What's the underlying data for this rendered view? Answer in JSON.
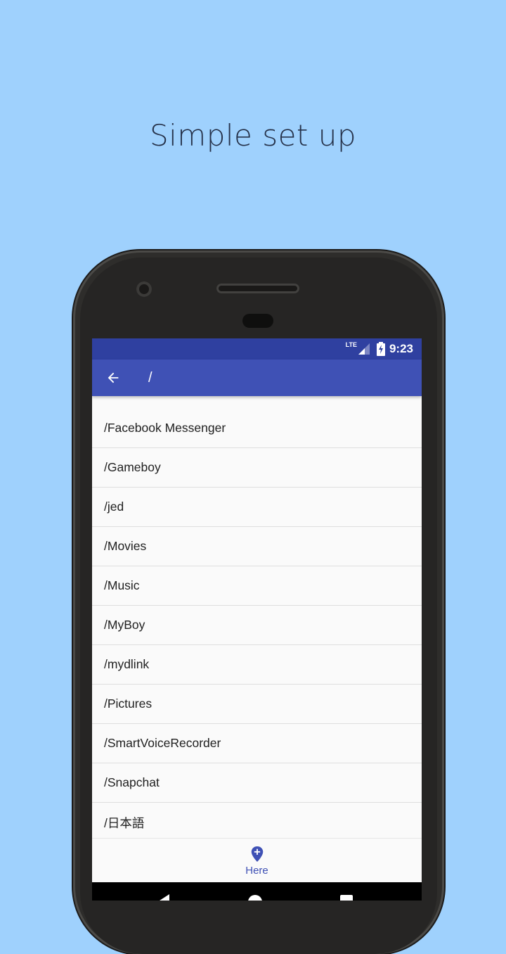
{
  "headline": "Simple set up",
  "status_bar": {
    "network": "LTE",
    "time": "9:23"
  },
  "app_bar": {
    "back_icon": "arrow-back-icon",
    "title": "/"
  },
  "folders": [
    "/Facebook Messenger",
    "/Gameboy",
    "/jed",
    "/Movies",
    "/Music",
    "/MyBoy",
    "/mydlink",
    "/Pictures",
    "/SmartVoiceRecorder",
    "/Snapchat",
    "/日本語"
  ],
  "bottom_nav": {
    "icon": "add-location-icon",
    "label": "Here"
  },
  "colors": {
    "background": "#9fd1fd",
    "primary": "#3f51b5",
    "primary_dark": "#2f40a0"
  }
}
